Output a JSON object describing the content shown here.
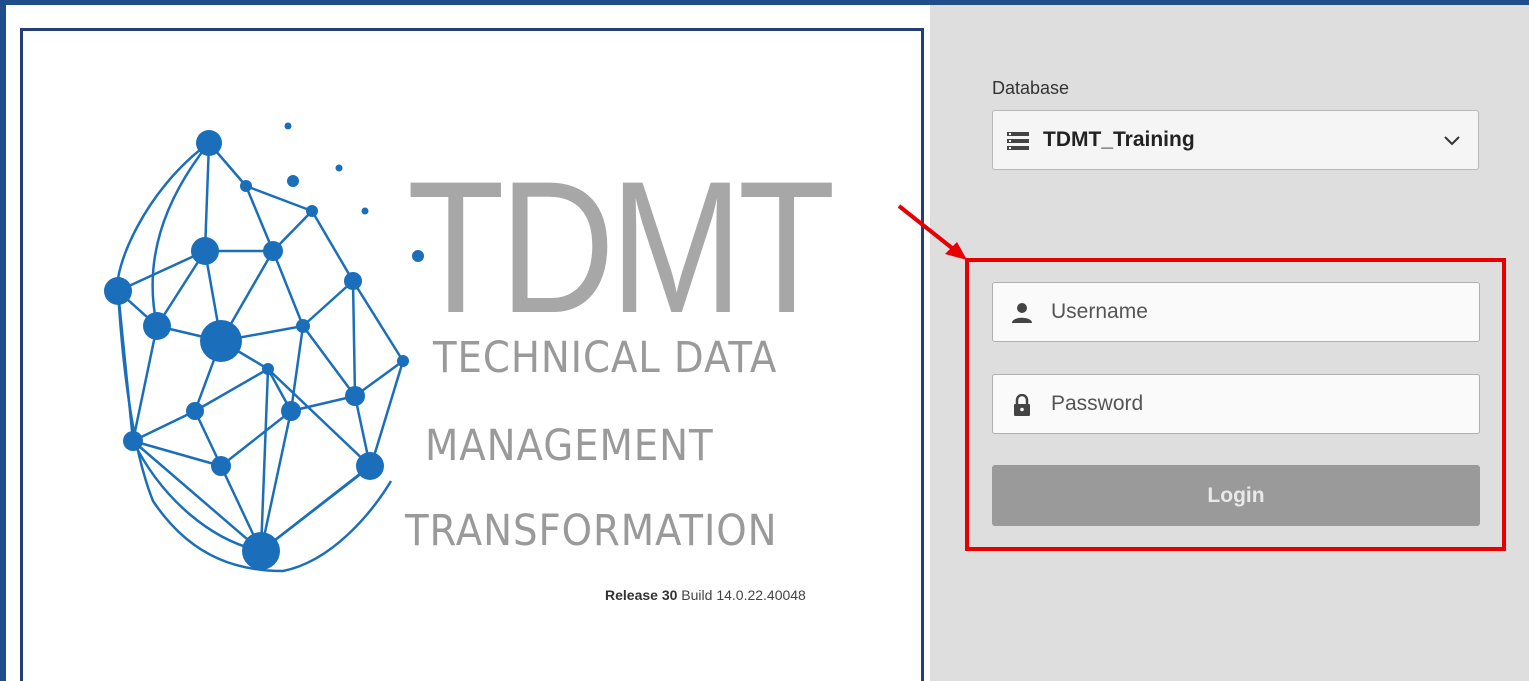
{
  "splash": {
    "brand_title": "TDMT",
    "brand_lines": [
      "TECHNICAL DATA",
      "MANAGEMENT",
      "TRANSFORMATION"
    ],
    "release_label": "Release 30",
    "build_label": "Build 14.0.22.40048"
  },
  "login": {
    "database_label": "Database",
    "database_value": "TDMT_Training",
    "username_placeholder": "Username",
    "password_placeholder": "Password",
    "login_button": "Login"
  },
  "colors": {
    "accent_frame": "#1f4e8c",
    "highlight": "#e60000",
    "network_blue": "#1b6fba",
    "brand_gray": "#a7a7a7",
    "panel_bg": "#dedede",
    "button_bg": "#9a9a9a"
  },
  "icons": {
    "database": "database-icon",
    "dropdown": "chevron-down-icon",
    "user": "user-icon",
    "lock": "lock-icon",
    "logo": "network-globe-logo",
    "annotation": "red-arrow-annotation"
  }
}
